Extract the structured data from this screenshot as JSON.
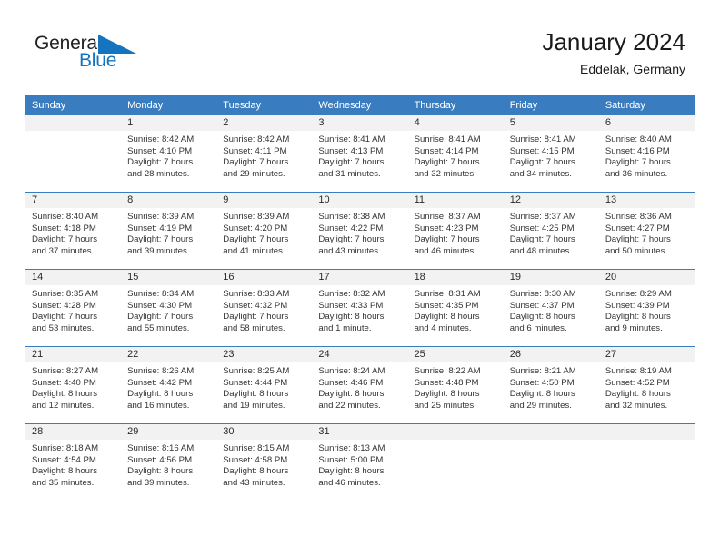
{
  "brand": {
    "name_part1": "General",
    "name_part2": "Blue",
    "color_dark": "#231f20",
    "color_blue": "#1574bf",
    "triangle_icon": "triangle-icon"
  },
  "header": {
    "title": "January 2024",
    "subtitle": "Eddelak, Germany",
    "accent_color": "#3a7cc0"
  },
  "weekdays": [
    "Sunday",
    "Monday",
    "Tuesday",
    "Wednesday",
    "Thursday",
    "Friday",
    "Saturday"
  ],
  "weeks": [
    [
      {
        "day": "",
        "lines": [
          "",
          "",
          "",
          ""
        ],
        "empty": true
      },
      {
        "day": "1",
        "lines": [
          "Sunrise: 8:42 AM",
          "Sunset: 4:10 PM",
          "Daylight: 7 hours",
          "and 28 minutes."
        ]
      },
      {
        "day": "2",
        "lines": [
          "Sunrise: 8:42 AM",
          "Sunset: 4:11 PM",
          "Daylight: 7 hours",
          "and 29 minutes."
        ]
      },
      {
        "day": "3",
        "lines": [
          "Sunrise: 8:41 AM",
          "Sunset: 4:13 PM",
          "Daylight: 7 hours",
          "and 31 minutes."
        ]
      },
      {
        "day": "4",
        "lines": [
          "Sunrise: 8:41 AM",
          "Sunset: 4:14 PM",
          "Daylight: 7 hours",
          "and 32 minutes."
        ]
      },
      {
        "day": "5",
        "lines": [
          "Sunrise: 8:41 AM",
          "Sunset: 4:15 PM",
          "Daylight: 7 hours",
          "and 34 minutes."
        ]
      },
      {
        "day": "6",
        "lines": [
          "Sunrise: 8:40 AM",
          "Sunset: 4:16 PM",
          "Daylight: 7 hours",
          "and 36 minutes."
        ]
      }
    ],
    [
      {
        "day": "7",
        "lines": [
          "Sunrise: 8:40 AM",
          "Sunset: 4:18 PM",
          "Daylight: 7 hours",
          "and 37 minutes."
        ]
      },
      {
        "day": "8",
        "lines": [
          "Sunrise: 8:39 AM",
          "Sunset: 4:19 PM",
          "Daylight: 7 hours",
          "and 39 minutes."
        ]
      },
      {
        "day": "9",
        "lines": [
          "Sunrise: 8:39 AM",
          "Sunset: 4:20 PM",
          "Daylight: 7 hours",
          "and 41 minutes."
        ]
      },
      {
        "day": "10",
        "lines": [
          "Sunrise: 8:38 AM",
          "Sunset: 4:22 PM",
          "Daylight: 7 hours",
          "and 43 minutes."
        ]
      },
      {
        "day": "11",
        "lines": [
          "Sunrise: 8:37 AM",
          "Sunset: 4:23 PM",
          "Daylight: 7 hours",
          "and 46 minutes."
        ]
      },
      {
        "day": "12",
        "lines": [
          "Sunrise: 8:37 AM",
          "Sunset: 4:25 PM",
          "Daylight: 7 hours",
          "and 48 minutes."
        ]
      },
      {
        "day": "13",
        "lines": [
          "Sunrise: 8:36 AM",
          "Sunset: 4:27 PM",
          "Daylight: 7 hours",
          "and 50 minutes."
        ]
      }
    ],
    [
      {
        "day": "14",
        "lines": [
          "Sunrise: 8:35 AM",
          "Sunset: 4:28 PM",
          "Daylight: 7 hours",
          "and 53 minutes."
        ]
      },
      {
        "day": "15",
        "lines": [
          "Sunrise: 8:34 AM",
          "Sunset: 4:30 PM",
          "Daylight: 7 hours",
          "and 55 minutes."
        ]
      },
      {
        "day": "16",
        "lines": [
          "Sunrise: 8:33 AM",
          "Sunset: 4:32 PM",
          "Daylight: 7 hours",
          "and 58 minutes."
        ]
      },
      {
        "day": "17",
        "lines": [
          "Sunrise: 8:32 AM",
          "Sunset: 4:33 PM",
          "Daylight: 8 hours",
          "and 1 minute."
        ]
      },
      {
        "day": "18",
        "lines": [
          "Sunrise: 8:31 AM",
          "Sunset: 4:35 PM",
          "Daylight: 8 hours",
          "and 4 minutes."
        ]
      },
      {
        "day": "19",
        "lines": [
          "Sunrise: 8:30 AM",
          "Sunset: 4:37 PM",
          "Daylight: 8 hours",
          "and 6 minutes."
        ]
      },
      {
        "day": "20",
        "lines": [
          "Sunrise: 8:29 AM",
          "Sunset: 4:39 PM",
          "Daylight: 8 hours",
          "and 9 minutes."
        ]
      }
    ],
    [
      {
        "day": "21",
        "lines": [
          "Sunrise: 8:27 AM",
          "Sunset: 4:40 PM",
          "Daylight: 8 hours",
          "and 12 minutes."
        ]
      },
      {
        "day": "22",
        "lines": [
          "Sunrise: 8:26 AM",
          "Sunset: 4:42 PM",
          "Daylight: 8 hours",
          "and 16 minutes."
        ]
      },
      {
        "day": "23",
        "lines": [
          "Sunrise: 8:25 AM",
          "Sunset: 4:44 PM",
          "Daylight: 8 hours",
          "and 19 minutes."
        ]
      },
      {
        "day": "24",
        "lines": [
          "Sunrise: 8:24 AM",
          "Sunset: 4:46 PM",
          "Daylight: 8 hours",
          "and 22 minutes."
        ]
      },
      {
        "day": "25",
        "lines": [
          "Sunrise: 8:22 AM",
          "Sunset: 4:48 PM",
          "Daylight: 8 hours",
          "and 25 minutes."
        ]
      },
      {
        "day": "26",
        "lines": [
          "Sunrise: 8:21 AM",
          "Sunset: 4:50 PM",
          "Daylight: 8 hours",
          "and 29 minutes."
        ]
      },
      {
        "day": "27",
        "lines": [
          "Sunrise: 8:19 AM",
          "Sunset: 4:52 PM",
          "Daylight: 8 hours",
          "and 32 minutes."
        ]
      }
    ],
    [
      {
        "day": "28",
        "lines": [
          "Sunrise: 8:18 AM",
          "Sunset: 4:54 PM",
          "Daylight: 8 hours",
          "and 35 minutes."
        ]
      },
      {
        "day": "29",
        "lines": [
          "Sunrise: 8:16 AM",
          "Sunset: 4:56 PM",
          "Daylight: 8 hours",
          "and 39 minutes."
        ]
      },
      {
        "day": "30",
        "lines": [
          "Sunrise: 8:15 AM",
          "Sunset: 4:58 PM",
          "Daylight: 8 hours",
          "and 43 minutes."
        ]
      },
      {
        "day": "31",
        "lines": [
          "Sunrise: 8:13 AM",
          "Sunset: 5:00 PM",
          "Daylight: 8 hours",
          "and 46 minutes."
        ]
      },
      {
        "day": "",
        "lines": [
          "",
          "",
          "",
          ""
        ],
        "empty": true
      },
      {
        "day": "",
        "lines": [
          "",
          "",
          "",
          ""
        ],
        "empty": true
      },
      {
        "day": "",
        "lines": [
          "",
          "",
          "",
          ""
        ],
        "empty": true
      }
    ]
  ]
}
